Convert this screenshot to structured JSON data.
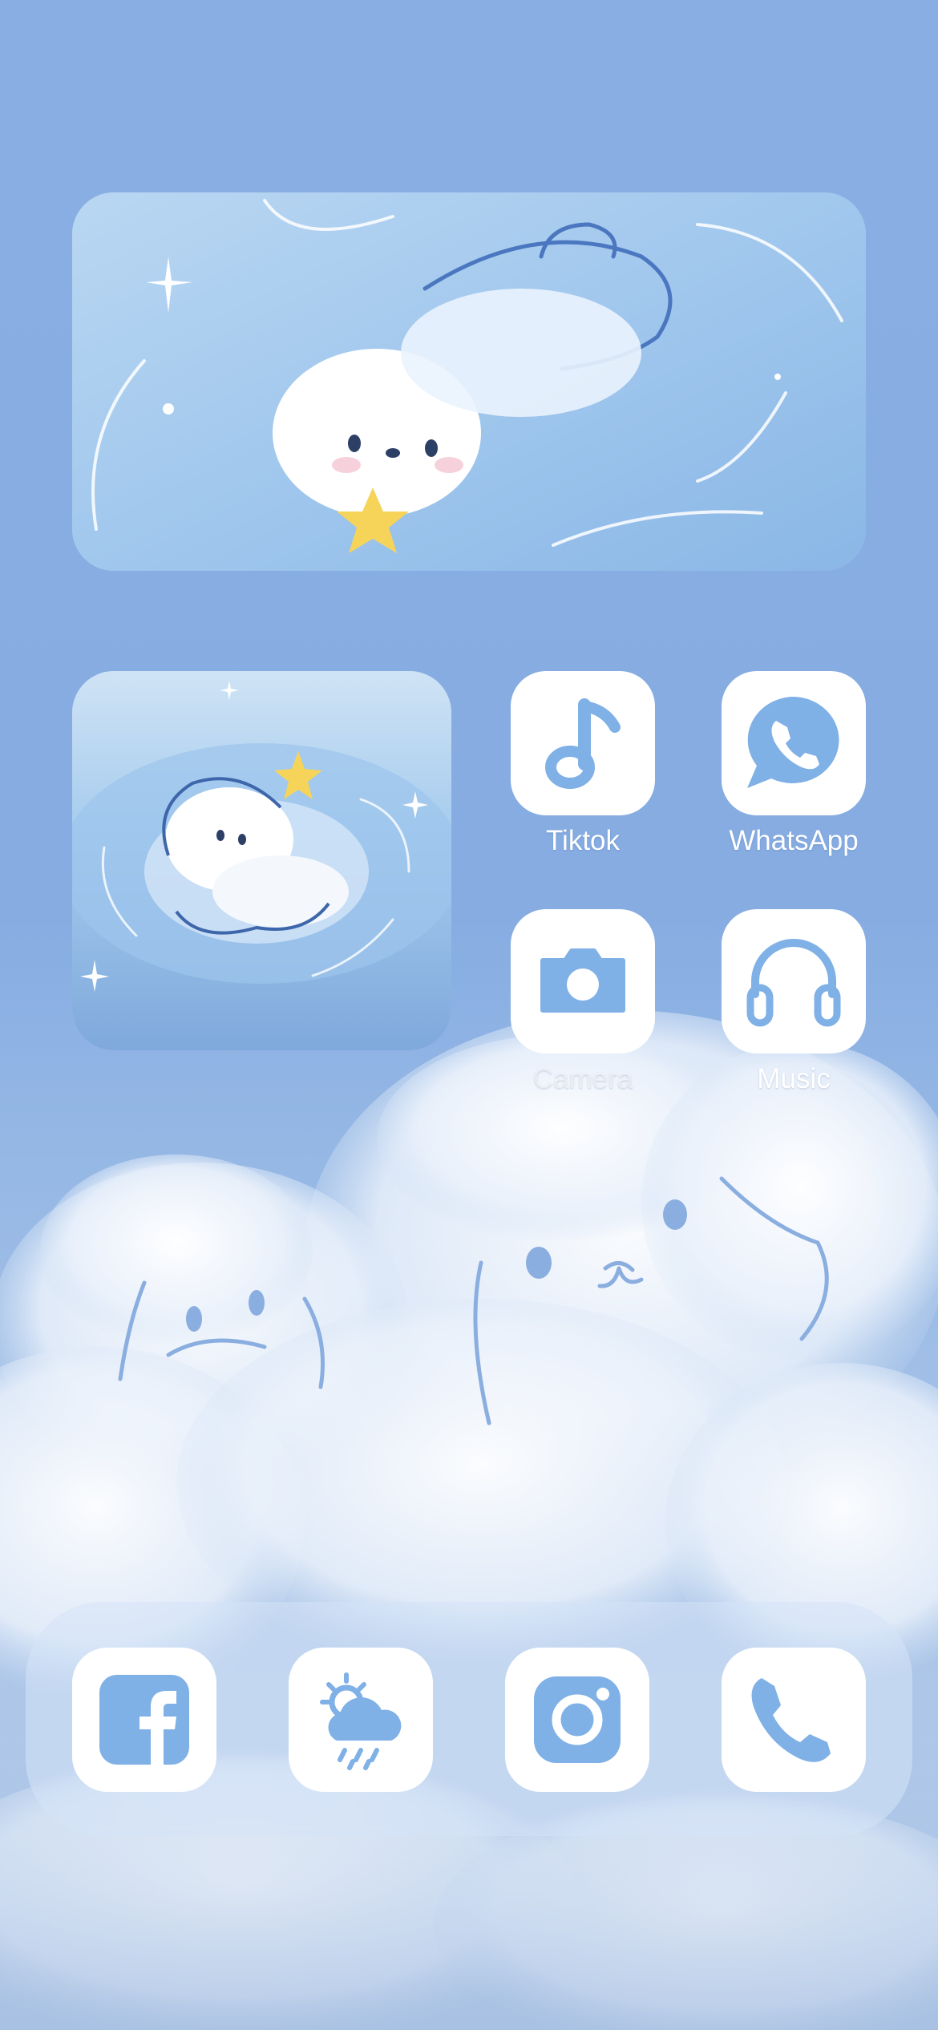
{
  "wallpaper": {
    "sky_color": "#88aee3",
    "cloud_color": "#ffffff"
  },
  "widgets": [
    {
      "name": "photo-widget-large",
      "content": "floating-puppy-illustration"
    },
    {
      "name": "photo-widget-small",
      "content": "puppy-in-water-illustration"
    }
  ],
  "apps": {
    "tiktok": {
      "label": "Tiktok",
      "icon": "music-note-icon"
    },
    "whatsapp": {
      "label": "WhatsApp",
      "icon": "whatsapp-phone-bubble-icon"
    },
    "camera": {
      "label": "Camera",
      "icon": "camera-icon"
    },
    "music": {
      "label": "Music",
      "icon": "headphones-icon"
    }
  },
  "dock": {
    "apps": [
      {
        "icon": "facebook-icon"
      },
      {
        "icon": "weather-icon"
      },
      {
        "icon": "instagram-icon"
      },
      {
        "icon": "phone-icon"
      }
    ]
  },
  "colors": {
    "icon_blue": "#7fb0e6",
    "tile_white": "#ffffff",
    "dock_tint": "#d6e4f8"
  }
}
